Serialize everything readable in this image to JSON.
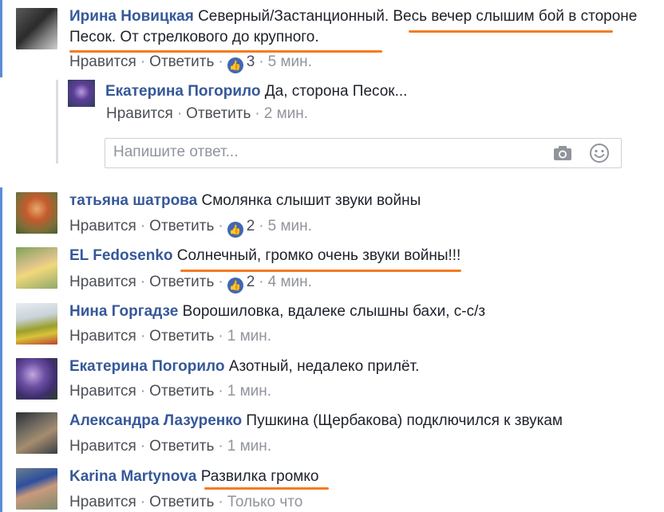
{
  "actions": {
    "like": "Нравится",
    "reply": "Ответить"
  },
  "comments": [
    {
      "author": "Ирина Новицкая",
      "text": "Северный/Застанционный. Весь вечер слышим бой в стороне Песок. От стрелкового до крупного.",
      "likes": "3",
      "time": "5 мин."
    },
    {
      "author": "татьяна шатрова",
      "text": "Смолянка слышит звуки войны",
      "likes": "2",
      "time": "5 мин."
    },
    {
      "author": "EL Fedosenko",
      "text": "Солнечный, громко очень звуки войны!!!",
      "likes": "2",
      "time": "4 мин."
    },
    {
      "author": "Нина Горгадзе",
      "text": "Ворошиловка, вдалеке слышны бахи, с-с/з",
      "time": "1 мин."
    },
    {
      "author": "Екатерина Погорило",
      "text": "Азотный, недалеко прилёт.",
      "time": "1 мин."
    },
    {
      "author": "Александра Лазуренко",
      "text": "Пушкина (Щербакова) подключился к звукам",
      "time": "1 мин."
    },
    {
      "author": "Karina Martynova",
      "text": "Развилка громко",
      "time": "Только что"
    }
  ],
  "reply": {
    "author": "Екатерина Погорило",
    "text": "Да, сторона Песок...",
    "time": "2 мин."
  },
  "reply_box": {
    "placeholder": "Напишите ответ...",
    "icons": [
      "camera-icon",
      "emoji-icon"
    ]
  },
  "colors": {
    "author": "#365899",
    "meta": "#90949c",
    "like_badge": "#4267b2",
    "highlight_underline": "#f47b20",
    "thread_bar": "#5b8bd6"
  }
}
